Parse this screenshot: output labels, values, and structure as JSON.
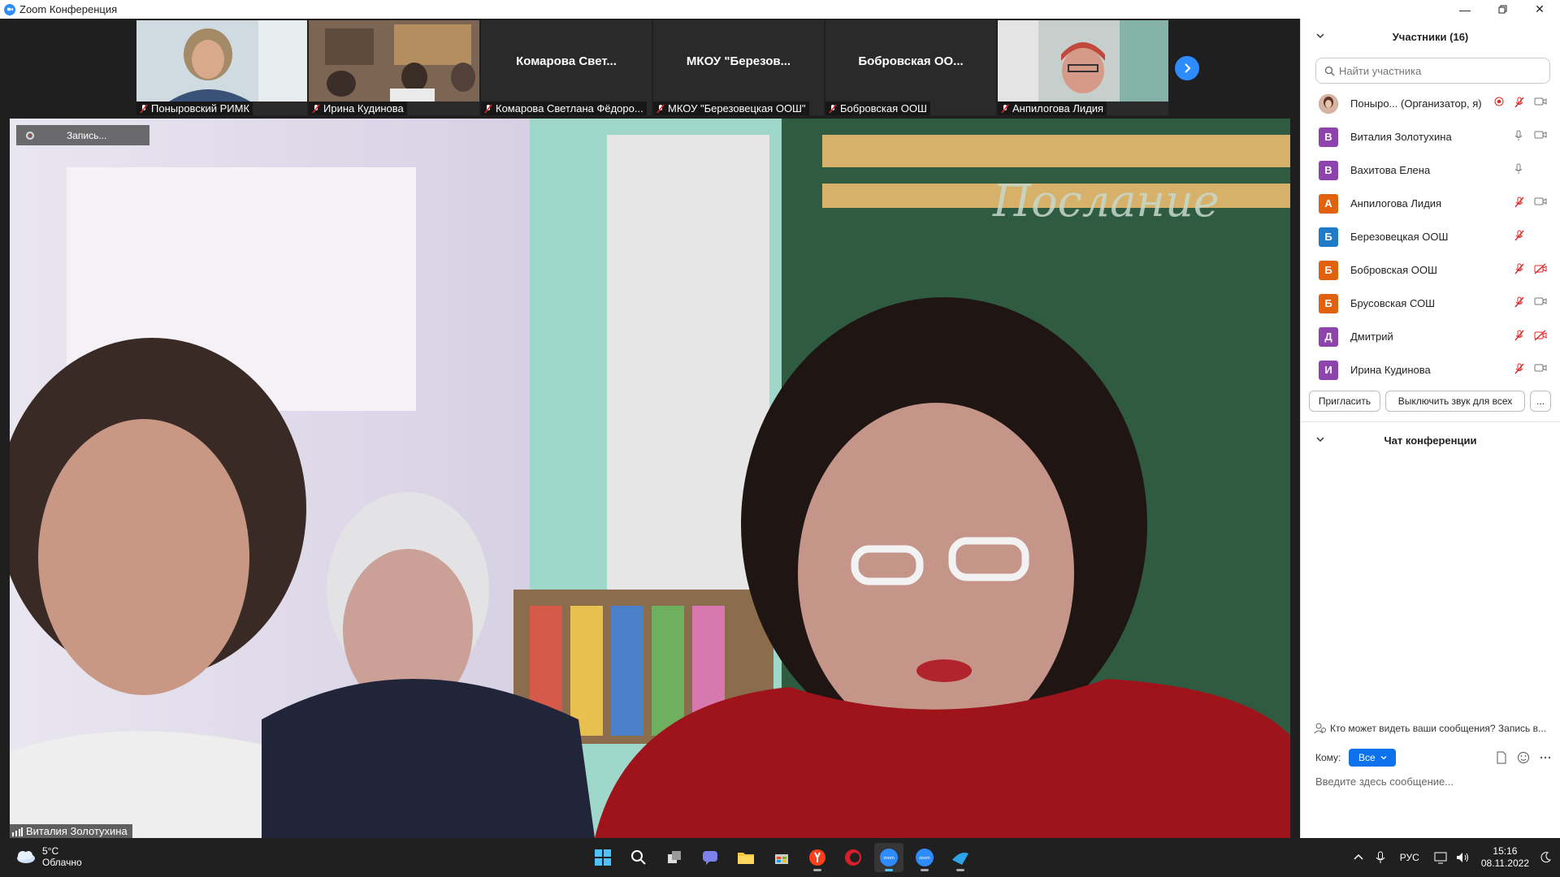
{
  "window": {
    "title": "Zoom Конференция"
  },
  "thumbnails": [
    {
      "name": "Понырoвский РИМК",
      "has_video": true,
      "bg": "#c9d5dc"
    },
    {
      "name": "Ирина Кудинова",
      "has_video": true,
      "bg": "#8a6f5a"
    },
    {
      "name": "Комарова Светлана Фёдоро...",
      "big_label": "Комарова Свет...",
      "has_video": false
    },
    {
      "name": "МКОУ \"Березовецкая ООШ\"",
      "big_label": "МКОУ \"Березов...",
      "has_video": false
    },
    {
      "name": "Бобровская ООШ",
      "big_label": "Бобровская ОО...",
      "has_video": false
    },
    {
      "name": "Анпилогова Лидия",
      "has_video": true,
      "bg": "#b9c4c0"
    }
  ],
  "main_video": {
    "recording_label": "Запись...",
    "speaker_name": "Виталия Золотухина"
  },
  "participants_panel": {
    "title": "Участники (16)",
    "search_placeholder": "Найти участника",
    "participants": [
      {
        "initial": "",
        "name": "Поныро...  (Организатор, я)",
        "color": "#6b4a3a",
        "photo": true,
        "mic": "muted",
        "video": "on",
        "rec": true
      },
      {
        "initial": "В",
        "name": "Виталия Золотухина",
        "color": "#8e44ad",
        "mic": "on",
        "video": "on"
      },
      {
        "initial": "В",
        "name": "Вахитова Елена",
        "color": "#8e44ad",
        "mic": "on",
        "video": "none"
      },
      {
        "initial": "А",
        "name": "Анпилогова Лидия",
        "color": "#e0610e",
        "mic": "muted",
        "video": "on"
      },
      {
        "initial": "Б",
        "name": "Березовецкая ООШ",
        "color": "#1f7ac8",
        "mic": "muted",
        "video": "none"
      },
      {
        "initial": "Б",
        "name": "Бобровская ООШ",
        "color": "#e0610e",
        "mic": "muted",
        "video": "off"
      },
      {
        "initial": "Б",
        "name": "Брусовская СОШ",
        "color": "#e0610e",
        "mic": "muted",
        "video": "on"
      },
      {
        "initial": "Д",
        "name": "Дмитрий",
        "color": "#8e44ad",
        "mic": "muted",
        "video": "off"
      },
      {
        "initial": "И",
        "name": "Ирина Кудинова",
        "color": "#8e44ad",
        "mic": "muted",
        "video": "on"
      }
    ],
    "invite_button": "Пригласить",
    "mute_all_button": "Выключить звук для всех",
    "more_button": "..."
  },
  "chat": {
    "title": "Чат конференции",
    "who_can_see": "Кто может видеть ваши сообщения? Запись в...",
    "to_label": "Кому:",
    "to_value": "Все",
    "input_placeholder": "Введите здесь сообщение..."
  },
  "taskbar": {
    "weather_temp": "5°C",
    "weather_desc": "Облачно",
    "lang": "РУС",
    "time": "15:16",
    "date": "08.11.2022"
  }
}
